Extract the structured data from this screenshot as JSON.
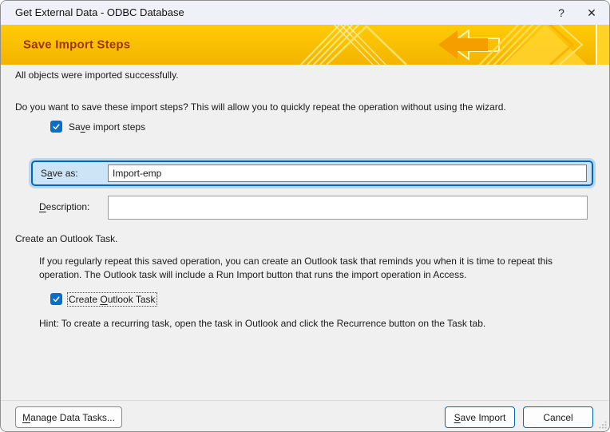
{
  "window": {
    "title": "Get External Data - ODBC Database",
    "help_glyph": "?",
    "close_glyph": "✕"
  },
  "banner": {
    "heading": "Save Import Steps"
  },
  "body": {
    "success_text": "All objects were imported successfully.",
    "prompt_text": "Do you want to save these import steps? This will allow you to quickly repeat the operation without using the wizard.",
    "save_steps_checkbox": {
      "checked": true,
      "label_pre": "Sa",
      "label_u": "v",
      "label_post": "e import steps"
    },
    "save_as": {
      "label_pre": "S",
      "label_u": "a",
      "label_post": "ve as:",
      "value": "Import-emp"
    },
    "description": {
      "label_pre": "",
      "label_u": "D",
      "label_post": "escription:",
      "value": ""
    },
    "outlook_heading": "Create an Outlook Task.",
    "outlook_paragraph": "If you regularly repeat this saved operation, you can create an Outlook task that reminds you when it is time to repeat this operation. The Outlook task will include a Run Import button that runs the import operation in Access.",
    "outlook_checkbox": {
      "checked": true,
      "label_pre": "Create ",
      "label_u": "O",
      "label_post": "utlook Task"
    },
    "hint_text": "Hint: To create a recurring task, open the task in Outlook and click the Recurrence button on the Task tab."
  },
  "footer": {
    "manage_button": {
      "label_pre": "",
      "label_u": "M",
      "label_post": "anage Data Tasks..."
    },
    "save_button": {
      "label_pre": "",
      "label_u": "S",
      "label_post": "ave Import"
    },
    "cancel_label": "Cancel"
  },
  "colors": {
    "accent_blue": "#0067C0",
    "checkbox_blue": "#0B6DCA",
    "focus_fill": "#CDE4F6",
    "banner_gold_top": "#FFCB05",
    "banner_gold_bottom": "#F3B400",
    "banner_heading": "#9C3412",
    "titlebar_bg": "#EEF2F8",
    "dialog_bg": "#F0F0F0"
  }
}
